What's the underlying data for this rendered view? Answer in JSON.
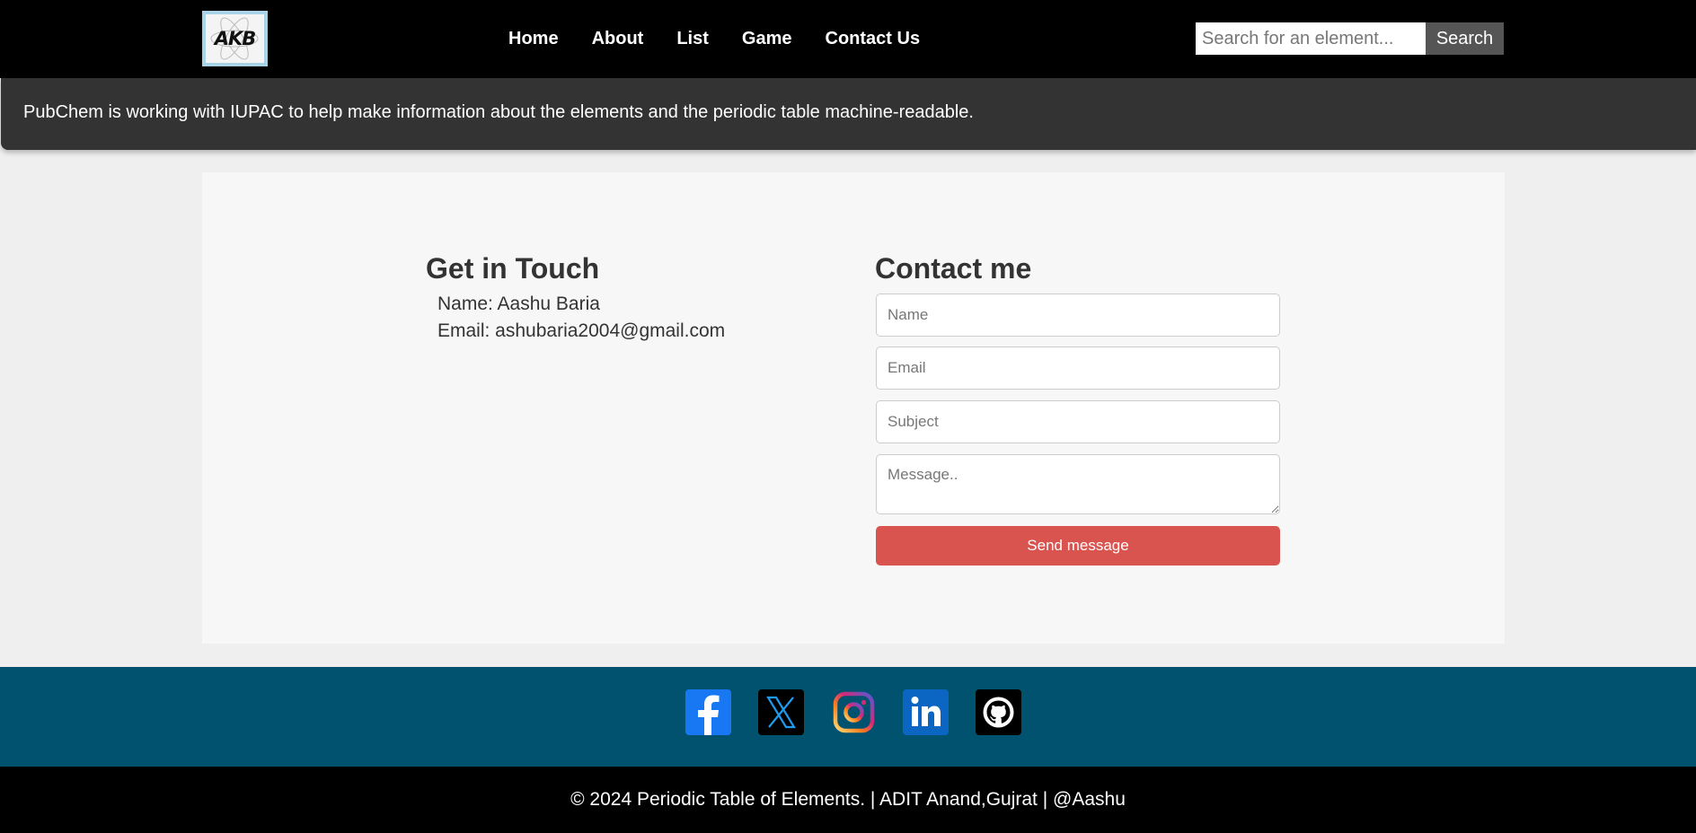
{
  "navbar": {
    "logo_text": "AKB",
    "links": [
      {
        "label": "Home"
      },
      {
        "label": "About"
      },
      {
        "label": "List"
      },
      {
        "label": "Game"
      },
      {
        "label": "Contact Us"
      }
    ],
    "search": {
      "placeholder": "Search for an element...",
      "value": "",
      "button_label": "Search"
    }
  },
  "banner": {
    "text": "PubChem is working with IUPAC to help make information about the elements and the periodic table machine-readable."
  },
  "get_in_touch": {
    "title": "Get in Touch",
    "name_line": "Name: Aashu Baria",
    "email_line": "Email: ashubaria2004@gmail.com"
  },
  "contact_form": {
    "title": "Contact me",
    "name_placeholder": "Name",
    "email_placeholder": "Email",
    "subject_placeholder": "Subject",
    "message_placeholder": "Message..",
    "send_label": "Send message"
  },
  "social": [
    {
      "icon": "facebook-icon",
      "color": "#1877f2"
    },
    {
      "icon": "x-twitter-icon",
      "color": "#000000"
    },
    {
      "icon": "instagram-icon",
      "color": "#e1306c"
    },
    {
      "icon": "linkedin-icon",
      "color": "#0a66c2"
    },
    {
      "icon": "github-icon",
      "color": "#000000"
    }
  ],
  "footer": {
    "text": "© 2024 Periodic Table of Elements. | ADIT Anand,Gujrat | @Aashu"
  },
  "colors": {
    "navbar_bg": "#000000",
    "banner_bg": "#333333",
    "send_button": "#d9534f",
    "social_strip_bg": "#00526e"
  }
}
